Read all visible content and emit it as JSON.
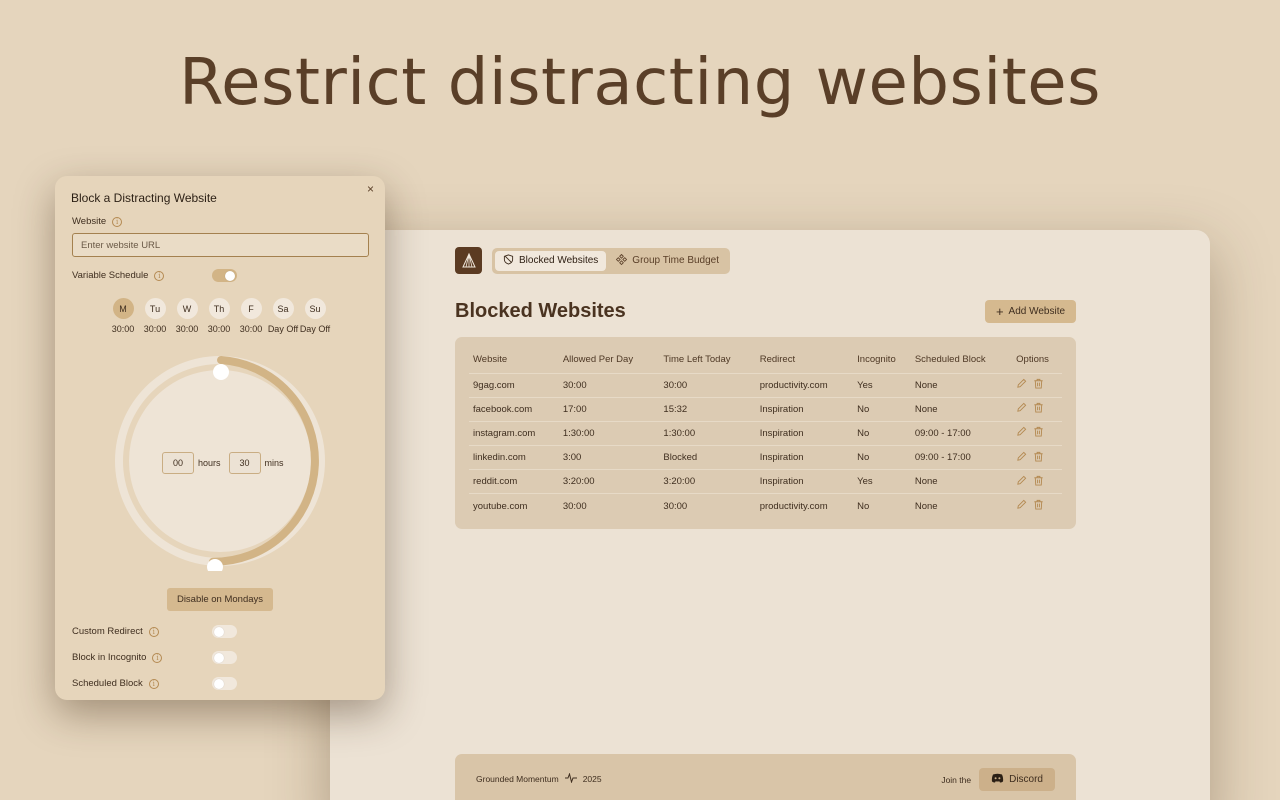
{
  "hero_title": "Restrict distracting websites",
  "app": {
    "nav": {
      "blocked_label": "Blocked Websites",
      "group_label": "Group Time Budget"
    },
    "page_title": "Blocked Websites",
    "add_button": "Add Website",
    "table": {
      "headers": [
        "Website",
        "Allowed Per Day",
        "Time Left Today",
        "Redirect",
        "Incognito",
        "Scheduled Block",
        "Options"
      ],
      "rows": [
        [
          "9gag.com",
          "30:00",
          "30:00",
          "productivity.com",
          "Yes",
          "None"
        ],
        [
          "facebook.com",
          "17:00",
          "15:32",
          "Inspiration",
          "No",
          "None"
        ],
        [
          "instagram.com",
          "1:30:00",
          "1:30:00",
          "Inspiration",
          "No",
          "09:00 - 17:00"
        ],
        [
          "linkedin.com",
          "3:00",
          "Blocked",
          "Inspiration",
          "No",
          "09:00 - 17:00"
        ],
        [
          "reddit.com",
          "3:20:00",
          "3:20:00",
          "Inspiration",
          "Yes",
          "None"
        ],
        [
          "youtube.com",
          "30:00",
          "30:00",
          "productivity.com",
          "No",
          "None"
        ]
      ]
    },
    "footer": {
      "brand": "Grounded Momentum",
      "year": "2025",
      "join_text": "Join the",
      "discord_label": "Discord"
    }
  },
  "modal": {
    "title": "Block a Distracting Website",
    "close": "×",
    "website_label": "Website",
    "website_placeholder": "Enter website URL",
    "variable_schedule_label": "Variable Schedule",
    "variable_schedule_on": true,
    "days": [
      {
        "short": "M",
        "value": "30:00",
        "active": true
      },
      {
        "short": "Tu",
        "value": "30:00",
        "active": false
      },
      {
        "short": "W",
        "value": "30:00",
        "active": false
      },
      {
        "short": "Th",
        "value": "30:00",
        "active": false
      },
      {
        "short": "F",
        "value": "30:00",
        "active": false
      },
      {
        "short": "Sa",
        "value": "Day Off",
        "active": false
      },
      {
        "short": "Su",
        "value": "Day Off",
        "active": false
      }
    ],
    "hours_value": "00",
    "hours_label": "hours",
    "mins_value": "30",
    "mins_label": "mins",
    "dial_fraction": 0.5,
    "disable_button": "Disable on Mondays",
    "custom_redirect_label": "Custom Redirect",
    "block_incognito_label": "Block in Incognito",
    "scheduled_block_label": "Scheduled Block",
    "info_glyph": "i"
  },
  "colors": {
    "background": "#e5d5bd",
    "accent": "#d2b486",
    "text": "#3f2e1f",
    "logo": "#5b3b22"
  }
}
